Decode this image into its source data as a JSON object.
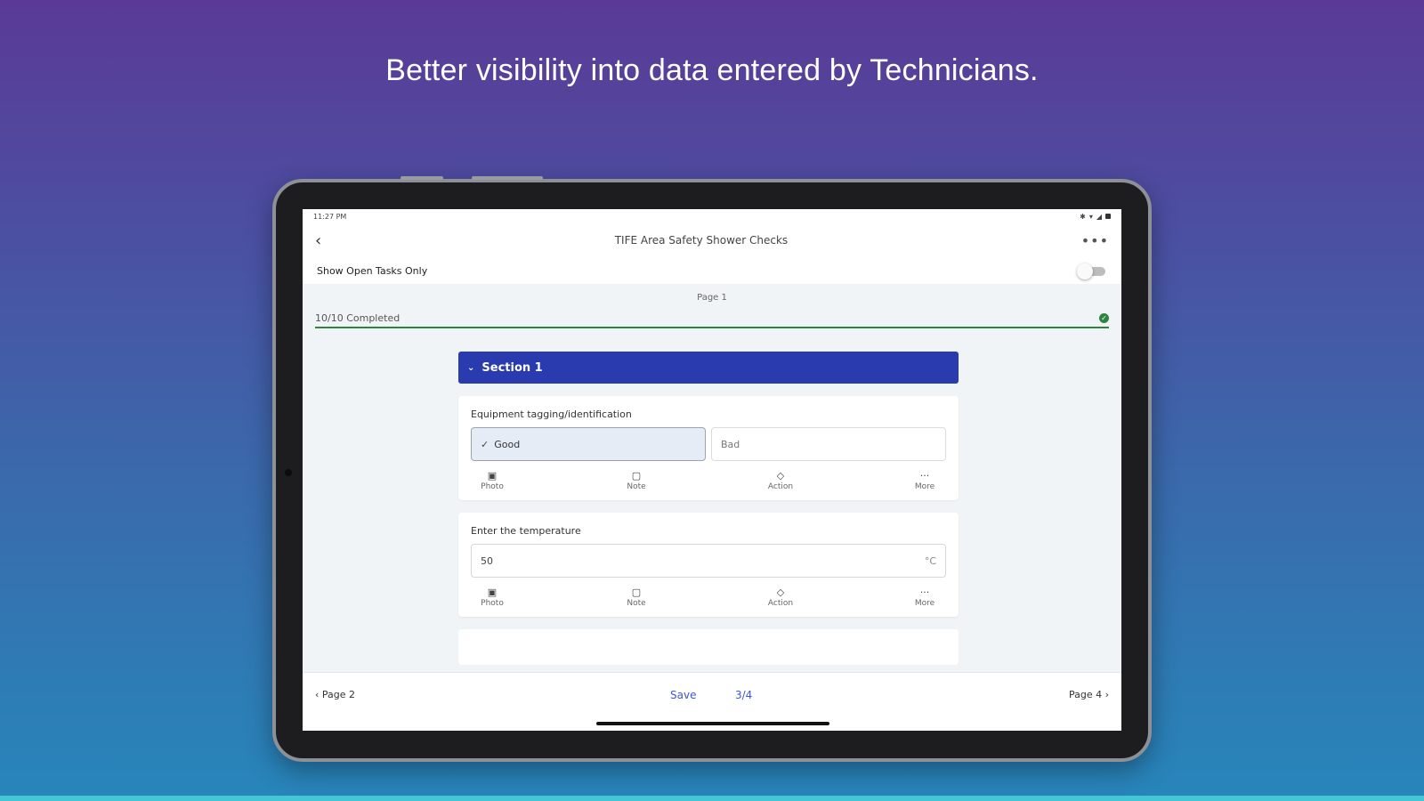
{
  "headline": "Better visibility into data entered by Technicians.",
  "status_bar": {
    "time": "11:27 PM"
  },
  "app_bar": {
    "title": "TIFE Area Safety Shower Checks",
    "more": "•••"
  },
  "filter": {
    "label": "Show Open Tasks Only",
    "toggle_on": false
  },
  "page_label": "Page 1",
  "progress": {
    "text": "10/10 Completed"
  },
  "section": {
    "title": "Section 1"
  },
  "questions": [
    {
      "label": "Equipment tagging/identification",
      "options": [
        "Good",
        "Bad"
      ],
      "selected": "Good"
    },
    {
      "label": "Enter the temperature",
      "value": "50",
      "unit": "°C"
    }
  ],
  "actions": {
    "photo": "Photo",
    "note": "Note",
    "action": "Action",
    "more": "More"
  },
  "bottom_bar": {
    "prev": "Page 2",
    "save": "Save",
    "count": "3/4",
    "next": "Page 4"
  },
  "colors": {
    "section_header": "#2a3bb0",
    "progress_green": "#2e8540",
    "link_blue": "#3d56d6"
  }
}
